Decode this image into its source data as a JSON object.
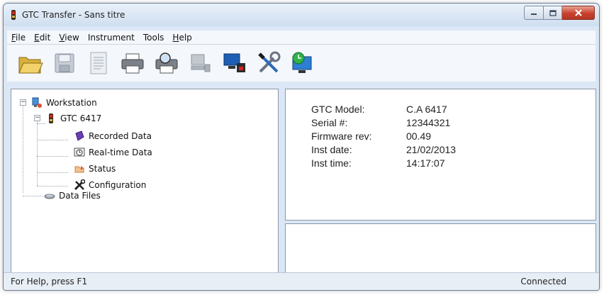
{
  "window": {
    "title": "GTC Transfer - Sans titre"
  },
  "menu": [
    "File",
    "Edit",
    "View",
    "Instrument",
    "Tools",
    "Help"
  ],
  "menu_underline": [
    0,
    0,
    0,
    -1,
    -1,
    0
  ],
  "toolbar": {
    "buttons": [
      "open-folder-icon",
      "save-icon",
      "document-icon",
      "print-icon",
      "print-preview-icon",
      "printer-setup-icon",
      "computer-transfer-icon",
      "delete-computer-icon",
      "tools-icon",
      "clock-monitor-icon"
    ]
  },
  "tree": {
    "root": "Workstation",
    "instrument": "GTC 6417",
    "children": [
      "Recorded Data",
      "Real-time Data",
      "Status",
      "Configuration"
    ],
    "data_files": "Data Files"
  },
  "info": {
    "rows": [
      {
        "label": "GTC Model:",
        "value": "C.A 6417"
      },
      {
        "label": "Serial #:",
        "value": "12344321"
      },
      {
        "label": "Firmware rev:",
        "value": "00.49"
      },
      {
        "label": "Inst date:",
        "value": "21/02/2013"
      },
      {
        "label": "Inst time:",
        "value": "14:17:07"
      }
    ]
  },
  "status": {
    "help": "For Help, press F1",
    "connection": "Connected"
  }
}
